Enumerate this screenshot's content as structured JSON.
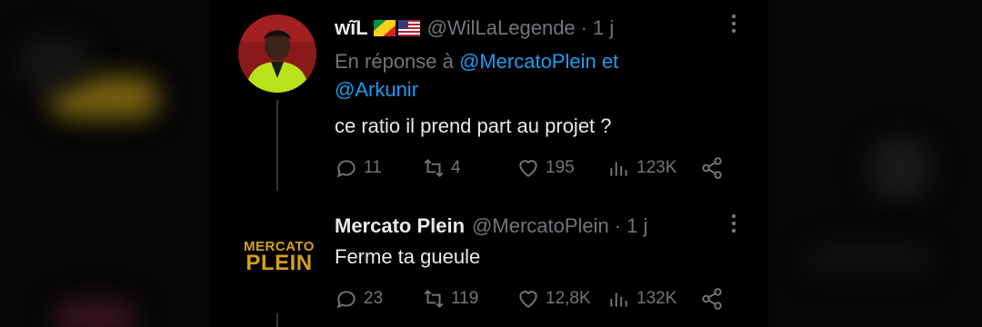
{
  "tweets": [
    {
      "name": "wĩL",
      "handle": "@WilLaLegende",
      "time": "1 j",
      "reply_prefix": "En réponse à",
      "mention_1": "@MercatoPlein",
      "reply_and": "et",
      "mention_2": "@Arkunir",
      "text": "ce ratio il prend part au projet ?",
      "replies": "11",
      "retweets": "4",
      "likes": "195",
      "views": "123K"
    },
    {
      "name": "Mercato Plein",
      "handle": "@MercatoPlein",
      "time": "1 j",
      "text": "Ferme ta gueule",
      "logo_line1": "MERCATO",
      "logo_line2": "PLEIN",
      "replies": "23",
      "retweets": "119",
      "likes": "12,8K",
      "views": "132K"
    }
  ],
  "icons": [
    "congo-flag-icon",
    "us-flag-icon",
    "more-icon",
    "reply-icon",
    "retweet-icon",
    "like-icon",
    "views-icon",
    "share-icon"
  ],
  "colors": {
    "background": "#000000",
    "text": "#e7e9ea",
    "muted": "#71767b",
    "link": "#1d9bf0",
    "logo_gold": "#d4a017"
  }
}
